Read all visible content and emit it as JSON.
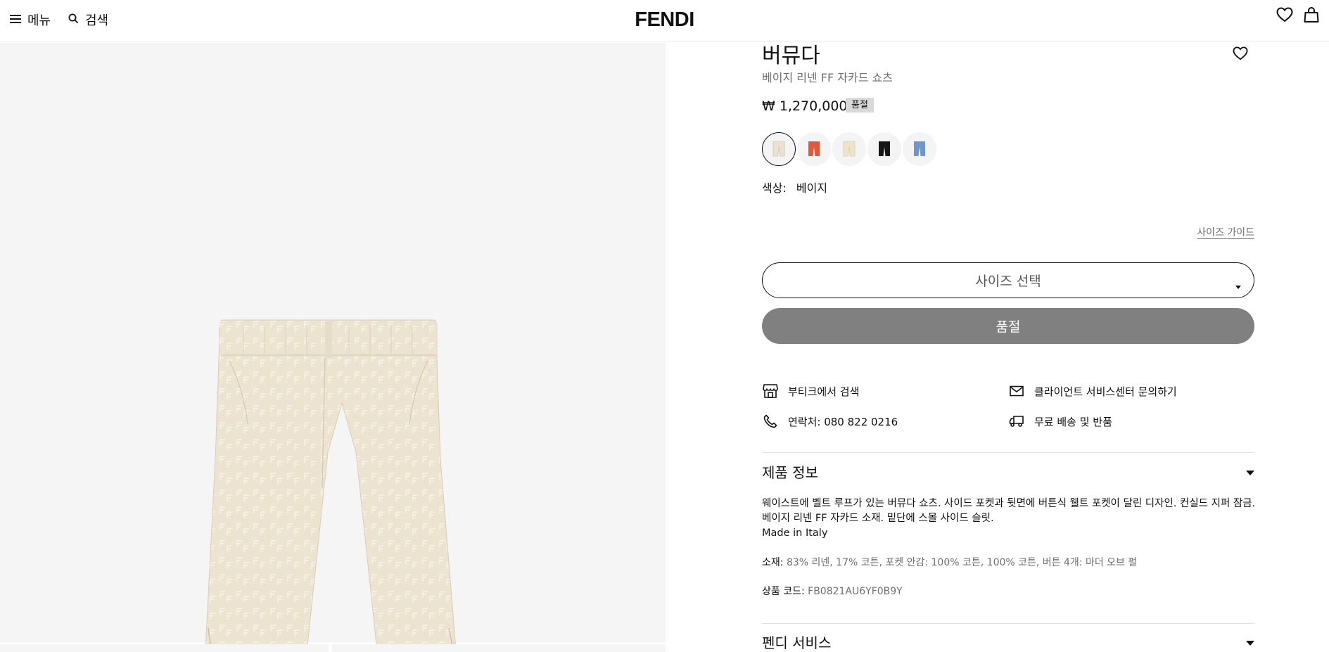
{
  "header": {
    "menu_label": "메뉴",
    "search_label": "검색",
    "brand": "FENDI"
  },
  "product": {
    "name": "버뮤다",
    "subtitle": "베이지 리넨 FF 자카드 쇼츠",
    "price": "₩ 1,270,000",
    "badge": "품절",
    "color_label": "색상:",
    "color_value": "베이지",
    "swatches": [
      {
        "color": "#e9e2d3",
        "selected": true
      },
      {
        "color": "#e2583b",
        "selected": false
      },
      {
        "color": "#efe4c9",
        "selected": false
      },
      {
        "color": "#161616",
        "selected": false
      },
      {
        "color": "#6f98c8",
        "selected": false
      }
    ]
  },
  "size": {
    "guide_label": "사이즈 가이드",
    "select_label": "사이즈 선택",
    "soldout_button": "품절"
  },
  "services": {
    "boutique": "부티크에서 검색",
    "client": "클라이언트 서비스센터 문의하기",
    "contact": "연락처: 080 822 0216",
    "shipping": "무료 배송 및 반품"
  },
  "info": {
    "title": "제품 정보",
    "desc_line1": "웨이스트에 벨트 루프가 있는 버뮤다 쇼츠. 사이드 포켓과 뒷면에 버튼식 웰트 포켓이 달린 디자인. 컨실드 지퍼 잠금.",
    "desc_line2": "베이지 리넨 FF 자카드 소재. 밑단에 스몰 사이드 슬릿.",
    "desc_line3": "Made in Italy",
    "material_label": "소재:",
    "material_value": "83% 리넨, 17% 코튼, 포켓 안감: 100% 코튼, 100% 코튼, 버튼 4개: 마더 오브 펄",
    "code_label": "상품 코드:",
    "code_value": "FB0821AU6YF0B9Y"
  },
  "service_section": {
    "title": "펜디 서비스"
  },
  "colors": {
    "page_bg": "#ffffff",
    "image_bg": "#f5f5f5",
    "soldout_button": "#808080",
    "badge_bg": "#d9d9d9",
    "product_fabric": "#eee5d4"
  }
}
